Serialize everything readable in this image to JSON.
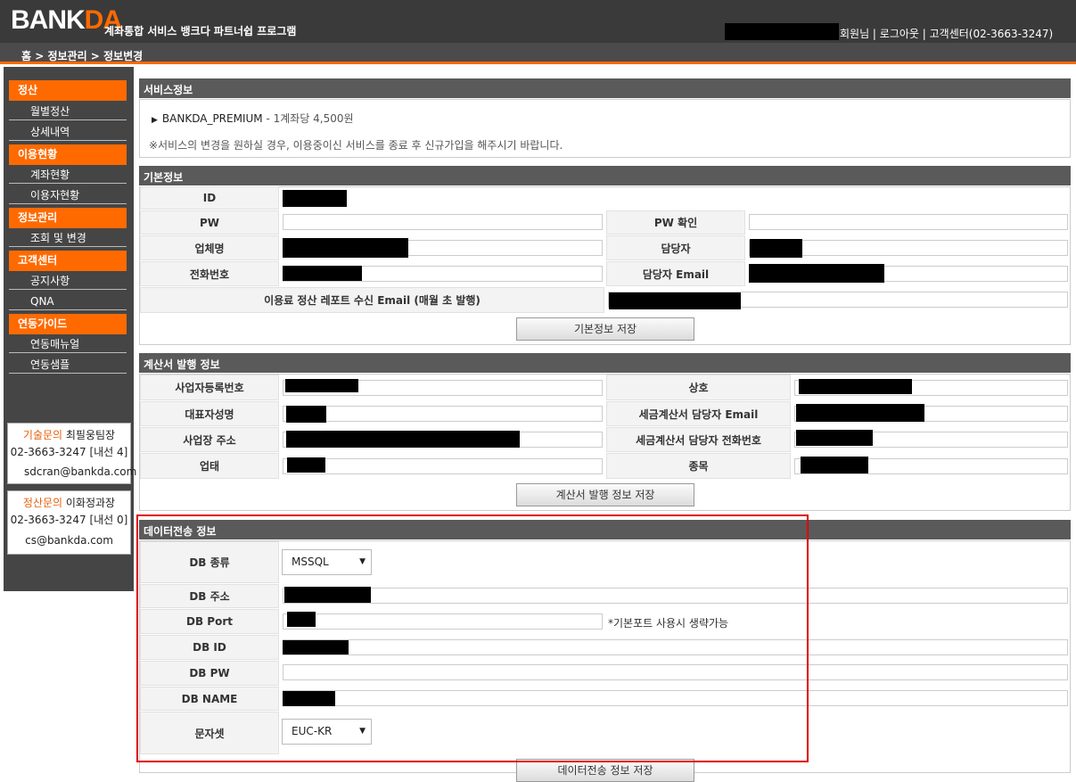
{
  "header": {
    "logo_a": "BANK",
    "logo_b": "DA",
    "subtitle": "계좌통합 서비스 뱅크다 파트너쉽 프로그램",
    "user_links": "회원님 | 로그아웃 | 고객센터(02-3663-3247)"
  },
  "breadcrumb": "홈  > 정보관리  > 정보변경",
  "sidebar": {
    "groups": [
      {
        "title": "정산",
        "items": [
          "월별정산",
          "상세내역"
        ]
      },
      {
        "title": "이용현황",
        "items": [
          "계좌현황",
          "이용자현황"
        ]
      },
      {
        "title": "정보관리",
        "items": [
          "조회 및 변경"
        ]
      },
      {
        "title": "고객센터",
        "items": [
          "공지사항",
          "QNA"
        ]
      },
      {
        "title": "연동가이드",
        "items": [
          "연동매뉴얼",
          "연동샘플"
        ]
      }
    ],
    "contact1": {
      "label": "기술문의",
      "name": " 최필웅팀장",
      "phone": "02-3663-3247 [내선 4]",
      "email": "sdcran@bankda.com"
    },
    "contact2": {
      "label": "정산문의",
      "name": " 이화정과장",
      "phone": "02-3663-3247 [내선 0]",
      "email": "cs@bankda.com"
    }
  },
  "service": {
    "title": "서비스정보",
    "product": "BANKDA_PREMIUM",
    "price": " - 1계좌당 4,500원",
    "notice": "※서비스의 변경을 원하실 경우, 이용중이신 서비스를 종료 후 신규가입을 해주시기 바랍니다."
  },
  "basic": {
    "title": "기본정보",
    "id": "ID",
    "pw": "PW",
    "pw_confirm": "PW 확인",
    "company": "업체명",
    "manager": "담당자",
    "phone": "전화번호",
    "manager_email": "담당자 Email",
    "report_email": "이용료 정산 레포트 수신 Email (매월 초 발행)",
    "save": "기본정보 저장"
  },
  "invoice": {
    "title": "계산서 발행 정보",
    "biz_no": "사업자등록번호",
    "trade_name": "상호",
    "ceo": "대표자성명",
    "tax_manager_email": "세금계산서 담당자 Email",
    "address": "사업장 주소",
    "tax_manager_phone": "세금계산서 담당자 전화번호",
    "biz_type": "업태",
    "biz_item": "종목",
    "save": "계산서 발행 정보 저장"
  },
  "transfer": {
    "title": "데이터전송 정보",
    "db_type": "DB 종류",
    "db_type_value": "MSSQL",
    "db_host": "DB 주소",
    "db_port": "DB Port",
    "port_hint": "*기본포트 사용시 생략가능",
    "db_id": "DB ID",
    "db_pw": "DB PW",
    "db_name": "DB NAME",
    "charset": "문자셋",
    "charset_value": "EUC-KR",
    "save": "데이터전송 정보 저장"
  }
}
